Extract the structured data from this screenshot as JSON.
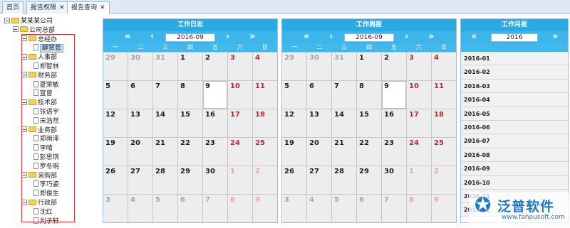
{
  "tabs": [
    {
      "label": "首页",
      "closable": false
    },
    {
      "label": "报告权限",
      "closable": true
    },
    {
      "label": "报告查询",
      "closable": true,
      "active": true
    }
  ],
  "tree": {
    "root": "某某某公司",
    "hq": "公司总部",
    "departments": [
      {
        "name": "总经办",
        "people": [
          "薛贺芸"
        ]
      },
      {
        "name": "人事部",
        "people": [
          "郑智林"
        ]
      },
      {
        "name": "财务部",
        "people": [
          "夏荣敏",
          "宣曾"
        ]
      },
      {
        "name": "技术部",
        "people": [
          "张语宇",
          "宋浩然"
        ]
      },
      {
        "name": "业务部",
        "people": [
          "郑雨泽",
          "李晴",
          "彭思琪",
          "罗冬明"
        ]
      },
      {
        "name": "采购部",
        "people": [
          "李巧姿",
          "郑俊生"
        ]
      },
      {
        "name": "行政部",
        "people": [
          "沈红",
          "刘子轩"
        ]
      }
    ],
    "selected": "薛贺芸"
  },
  "weekdays": [
    "一",
    "二",
    "三",
    "四",
    "五",
    "六",
    "日"
  ],
  "calendars": [
    {
      "title": "工作日志",
      "month": "2016-09"
    },
    {
      "title": "工作周报",
      "month": "2016-09"
    }
  ],
  "calendar_days": [
    [
      {
        "d": "29",
        "dim": true
      },
      {
        "d": "30",
        "dim": true
      },
      {
        "d": "31",
        "dim": true
      },
      {
        "d": "1"
      },
      {
        "d": "2"
      },
      {
        "d": "3",
        "red": true
      },
      {
        "d": "4",
        "red": true
      }
    ],
    [
      {
        "d": "5"
      },
      {
        "d": "6"
      },
      {
        "d": "7"
      },
      {
        "d": "8"
      },
      {
        "d": "9",
        "today": true
      },
      {
        "d": "10",
        "red": true
      },
      {
        "d": "11",
        "red": true
      }
    ],
    [
      {
        "d": "12"
      },
      {
        "d": "13"
      },
      {
        "d": "14"
      },
      {
        "d": "15"
      },
      {
        "d": "16"
      },
      {
        "d": "17",
        "red": true
      },
      {
        "d": "18",
        "red": true
      }
    ],
    [
      {
        "d": "19"
      },
      {
        "d": "20"
      },
      {
        "d": "21"
      },
      {
        "d": "22"
      },
      {
        "d": "23"
      },
      {
        "d": "24",
        "red": true
      },
      {
        "d": "25",
        "red": true
      }
    ],
    [
      {
        "d": "26"
      },
      {
        "d": "27"
      },
      {
        "d": "28"
      },
      {
        "d": "29"
      },
      {
        "d": "30"
      },
      {
        "d": "1",
        "red": true,
        "dim": true
      },
      {
        "d": "2",
        "red": true,
        "dim": true
      }
    ],
    [
      {
        "d": "3",
        "dim": true
      },
      {
        "d": "4",
        "dim": true
      },
      {
        "d": "5",
        "dim": true
      },
      {
        "d": "6",
        "dim": true
      },
      {
        "d": "7",
        "dim": true
      },
      {
        "d": "8",
        "red": true,
        "dim": true
      },
      {
        "d": "9",
        "red": true,
        "dim": true
      }
    ]
  ],
  "monthly": {
    "title": "工作月报",
    "year": "2016",
    "months": [
      "2016-01",
      "2016-02",
      "2016-03",
      "2016-04",
      "2016-05",
      "2016-06",
      "2016-07",
      "2016-08",
      "2016-09",
      "2016-10",
      "2016-11",
      "2016-12"
    ]
  },
  "watermark": {
    "brand": "泛普软件",
    "url": "www.fanpusoft.com"
  },
  "colors": {
    "header": "#2aa9e3",
    "weekend": "#c2262d",
    "tab_bar": "#dfe9f5"
  }
}
